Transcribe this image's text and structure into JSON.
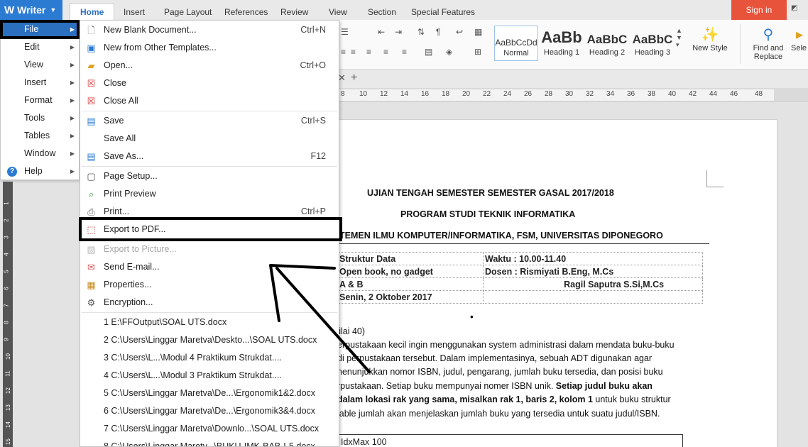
{
  "app": {
    "name": "Writer",
    "logo_glyph": "W",
    "accent": "#2b7bd3"
  },
  "tabs": [
    "Home",
    "Insert",
    "Page Layout",
    "References",
    "Review",
    "View",
    "Section",
    "Special Features"
  ],
  "signin_label": "Sign in",
  "ribbon": {
    "styles": [
      {
        "sample": "AaBbCcDd",
        "label": "Normal"
      },
      {
        "sample": "AaBb",
        "label": "Heading 1"
      },
      {
        "sample": "AaBbC",
        "label": "Heading 2"
      },
      {
        "sample": "AaBbC",
        "label": "Heading 3"
      }
    ],
    "new_style": "New Style",
    "find_replace": [
      "Find and",
      "Replace"
    ],
    "select": "Sele"
  },
  "ruler_numbers": [
    "8",
    "10",
    "12",
    "14",
    "16",
    "18",
    "20",
    "22",
    "24",
    "26",
    "28",
    "30",
    "32",
    "34",
    "36",
    "38",
    "40",
    "42",
    "44",
    "46",
    "48"
  ],
  "vruler_numbers": [
    "1",
    "2",
    "3",
    "4",
    "5",
    "6",
    "7",
    "8",
    "9",
    "10",
    "11",
    "12",
    "13",
    "14",
    "15"
  ],
  "main_menu": [
    {
      "label": "File",
      "arrow": true,
      "selected": true
    },
    {
      "label": "Edit",
      "arrow": true
    },
    {
      "label": "View",
      "arrow": true
    },
    {
      "label": "Insert",
      "arrow": true
    },
    {
      "label": "Format",
      "arrow": true
    },
    {
      "label": "Tools",
      "arrow": true
    },
    {
      "label": "Tables",
      "arrow": true
    },
    {
      "label": "Window",
      "arrow": true
    },
    {
      "label": "Help",
      "arrow": true
    }
  ],
  "file_menu": {
    "items": [
      {
        "label": "New Blank Document...",
        "shortcut": "Ctrl+N",
        "icon": "new-document-icon"
      },
      {
        "label": "New from Other Templates...",
        "shortcut": "",
        "icon": "template-icon"
      },
      {
        "label": "Open...",
        "shortcut": "Ctrl+O",
        "icon": "folder-open-icon"
      },
      {
        "label": "Close",
        "shortcut": "",
        "icon": "close-document-icon"
      },
      {
        "label": "Close All",
        "shortcut": "",
        "icon": "close-all-icon"
      },
      {
        "label": "Save",
        "shortcut": "Ctrl+S",
        "icon": "save-icon"
      },
      {
        "label": "Save All",
        "shortcut": "",
        "icon": ""
      },
      {
        "label": "Save As...",
        "shortcut": "F12",
        "icon": "save-as-icon"
      },
      {
        "label": "Page Setup...",
        "shortcut": "",
        "icon": "page-setup-icon"
      },
      {
        "label": "Print Preview",
        "shortcut": "",
        "icon": "print-preview-icon"
      },
      {
        "label": "Print...",
        "shortcut": "Ctrl+P",
        "icon": "printer-icon"
      },
      {
        "label": "Export to PDF...",
        "shortcut": "",
        "icon": "pdf-icon"
      },
      {
        "label": "Export to Picture...",
        "shortcut": "",
        "icon": "picture-icon",
        "disabled": true
      },
      {
        "label": "Send E-mail...",
        "shortcut": "",
        "icon": "email-icon"
      },
      {
        "label": "Properties...",
        "shortcut": "",
        "icon": "properties-icon"
      },
      {
        "label": "Encryption...",
        "shortcut": "",
        "icon": "encryption-icon"
      }
    ],
    "recent": [
      "1 E:\\FFOutput\\SOAL UTS.docx",
      "2 C:\\Users\\Linggar Maretva\\Deskto...\\SOAL UTS.docx",
      "3 C:\\Users\\L...\\Modul 4 Praktikum Strukdat....",
      "4 C:\\Users\\L...\\Modul 3 Praktikum Strukdat....",
      "5 C:\\Users\\Linggar Maretva\\De...\\Ergonomik1&2.docx",
      "6 C:\\Users\\Linggar Maretva\\De...\\Ergonomik3&4.docx",
      "7 C:\\Users\\Linggar Maretva\\Downlo...\\SOAL UTS.docx",
      "8 C:\\Users\\Linggar Maretv...\\BUKU-IMK-BAB-I-5.docx"
    ]
  },
  "document": {
    "title1": "UJIAN TENGAH SEMESTER SEMESTER GASAL 2017/2018",
    "title2": "PROGRAM STUDI TEKNIK INFORMATIKA",
    "title3": "TEMEN ILMU KOMPUTER/INFORMATIKA, FSM, UNIVERSITAS DIPONEGORO",
    "table": [
      [
        "Struktur Data",
        "Waktu          :      10.00-11.40"
      ],
      [
        "Open book, no gadget",
        "Dosen          :         Rismiyati B.Eng, M.Cs"
      ],
      [
        "A & B",
        "                                Ragil Saputra S.Si,M.Cs"
      ],
      [
        "Senin, 2 Oktober 2017",
        ""
      ]
    ],
    "bullet": "•",
    "lines": [
      "l nilai 40)",
      "erpustakaan kecil ingin menggunakan system administrasi dalam mendata buku-buku",
      "di perpustakaan tersebut. Dalam implementasinya, sebuah ADT digunakan agar",
      "nenunjukkan nomor ISBN, judul, pengarang, jumlah buku tersedia, dan posisi buku",
      "rpustakaan.  Setiap buku mempunyai nomer ISBN unik."
    ],
    "line5_bold": " Setiap judul buku akan",
    "line6_bold": " dalam lokasi rak yang sama,  misalkan  rak 1, baris 2, kolom 1",
    "line6_rest": "  untuk buku struktur",
    "line7": "iable jumlah akan menjelaskan jumlah buku yang tersedia untuk suatu judul/ISBN.",
    "box": "IdxMax 100"
  }
}
